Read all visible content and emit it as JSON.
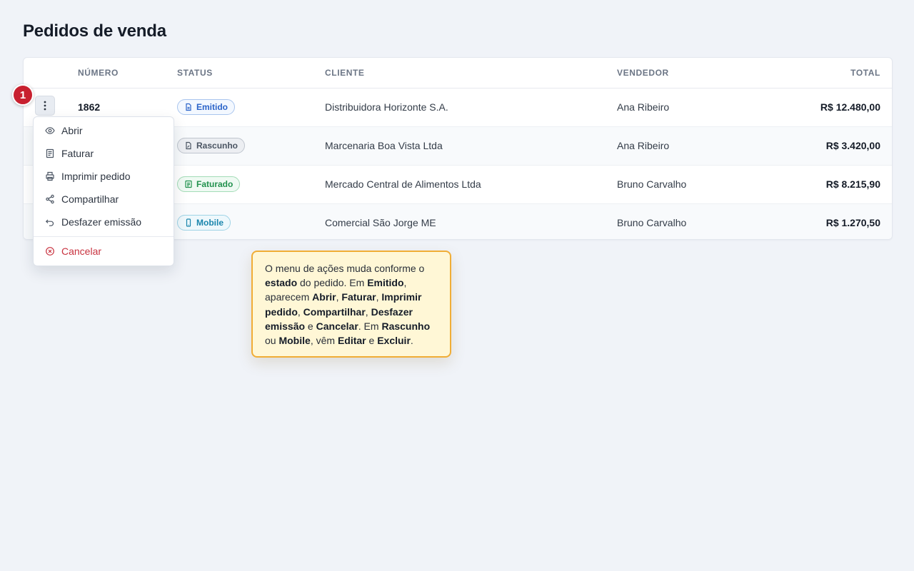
{
  "page": {
    "title": "Pedidos de venda"
  },
  "table": {
    "columns": [
      "NÚMERO",
      "STATUS",
      "CLIENTE",
      "VENDEDOR",
      "TOTAL"
    ],
    "rows": [
      {
        "numero": "1862",
        "status": "Emitido",
        "cliente": "Distribuidora Horizonte S.A.",
        "vendedor": "Ana Ribeiro",
        "total": "R$ 12.480,00"
      },
      {
        "numero": "",
        "status": "Rascunho",
        "cliente": "Marcenaria Boa Vista Ltda",
        "vendedor": "Ana Ribeiro",
        "total": "R$ 3.420,00"
      },
      {
        "numero": "",
        "status": "Faturado",
        "cliente": "Mercado Central de Alimentos Ltda",
        "vendedor": "Bruno Carvalho",
        "total": "R$ 8.215,90"
      },
      {
        "numero": "",
        "status": "Mobile",
        "cliente": "Comercial São Jorge ME",
        "vendedor": "Bruno Carvalho",
        "total": "R$ 1.270,50"
      }
    ]
  },
  "status_colors": {
    "Emitido": "#2a63c9",
    "Rascunho": "#4b5563",
    "Faturado": "#22924e",
    "Mobile": "#1a86ad"
  },
  "step_marker": "1",
  "actions_menu": {
    "items": [
      {
        "label": "Abrir",
        "icon": "eye-icon"
      },
      {
        "label": "Faturar",
        "icon": "invoice-icon"
      },
      {
        "label": "Imprimir pedido",
        "icon": "printer-icon"
      },
      {
        "label": "Compartilhar",
        "icon": "share-icon"
      },
      {
        "label": "Desfazer emissão",
        "icon": "undo-icon"
      }
    ],
    "danger_item": {
      "label": "Cancelar",
      "icon": "cancel-circle-icon",
      "color": "#c8323f"
    }
  },
  "callout": {
    "parts": [
      {
        "t": "O menu de ações muda conforme o ",
        "b": false
      },
      {
        "t": "estado",
        "b": true
      },
      {
        "t": " do pedido. Em ",
        "b": false
      },
      {
        "t": "Emitido",
        "b": true
      },
      {
        "t": ", aparecem ",
        "b": false
      },
      {
        "t": "Abrir",
        "b": true
      },
      {
        "t": ", ",
        "b": false
      },
      {
        "t": "Faturar",
        "b": true
      },
      {
        "t": ", ",
        "b": false
      },
      {
        "t": "Imprimir pedido",
        "b": true
      },
      {
        "t": ", ",
        "b": false
      },
      {
        "t": "Compartilhar",
        "b": true
      },
      {
        "t": ", ",
        "b": false
      },
      {
        "t": "Desfazer emissão",
        "b": true
      },
      {
        "t": " e ",
        "b": false
      },
      {
        "t": "Cancelar",
        "b": true
      },
      {
        "t": ". Em ",
        "b": false
      },
      {
        "t": "Rascunho",
        "b": true
      },
      {
        "t": " ou ",
        "b": false
      },
      {
        "t": "Mobile",
        "b": true
      },
      {
        "t": ", vêm ",
        "b": false
      },
      {
        "t": "Editar",
        "b": true
      },
      {
        "t": " e ",
        "b": false
      },
      {
        "t": "Excluir",
        "b": true
      },
      {
        "t": ".",
        "b": false
      }
    ]
  }
}
